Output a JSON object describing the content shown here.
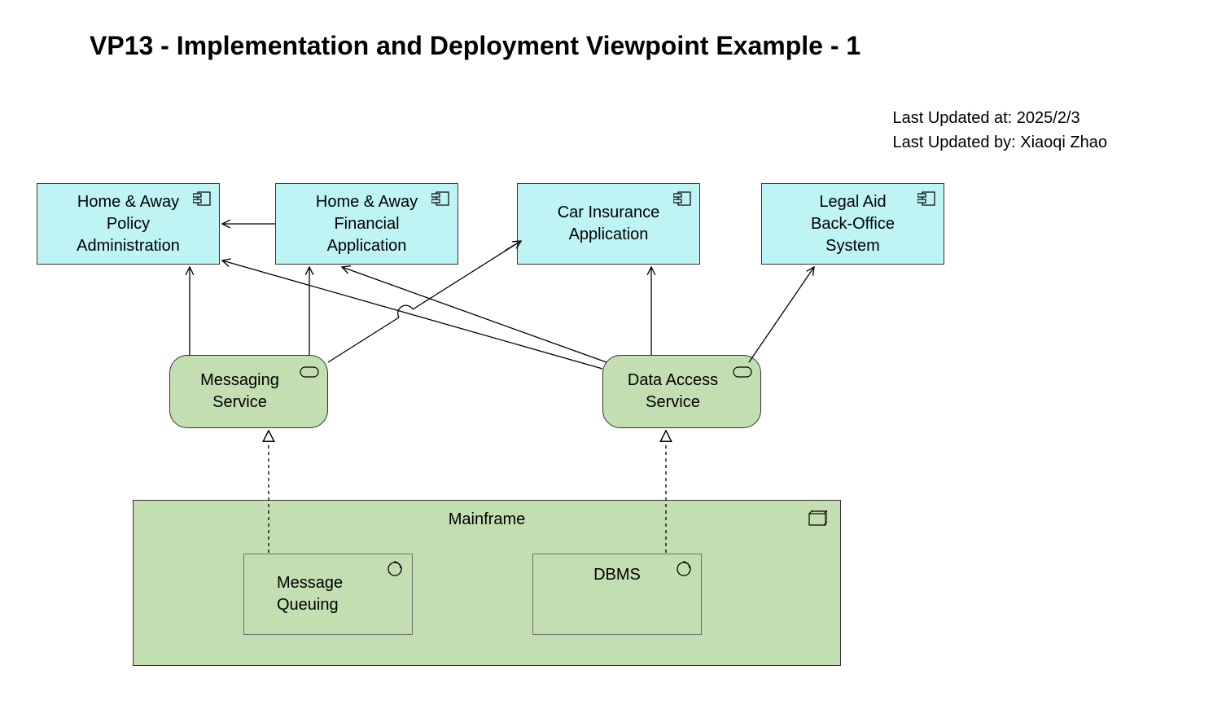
{
  "title": "VP13 - Implementation and Deployment Viewpoint Example - 1",
  "meta": {
    "updated_at_label": "Last Updated at: ",
    "updated_at": "2025/2/3",
    "updated_by_label": "Last Updated by: ",
    "updated_by": "Xiaoqi Zhao"
  },
  "nodes": {
    "policy_admin": {
      "line1": "Home & Away",
      "line2": "Policy",
      "line3": "Administration"
    },
    "financial_app": {
      "line1": "Home & Away",
      "line2": "Financial",
      "line3": "Application"
    },
    "car_insurance": {
      "line1": "Car Insurance",
      "line2": "Application"
    },
    "legal_aid": {
      "line1": "Legal Aid",
      "line2": "Back-Office",
      "line3": "System"
    },
    "messaging_svc": {
      "line1": "Messaging",
      "line2": "Service"
    },
    "data_access_svc": {
      "line1": "Data Access",
      "line2": "Service"
    },
    "mainframe": {
      "label": "Mainframe"
    },
    "msg_queuing": {
      "line1": "Message",
      "line2": "Queuing"
    },
    "dbms": {
      "label": "DBMS"
    }
  },
  "colors": {
    "app_comp_fill": "#bef4f4",
    "service_fill": "#c3deb0",
    "border": "#333333"
  }
}
